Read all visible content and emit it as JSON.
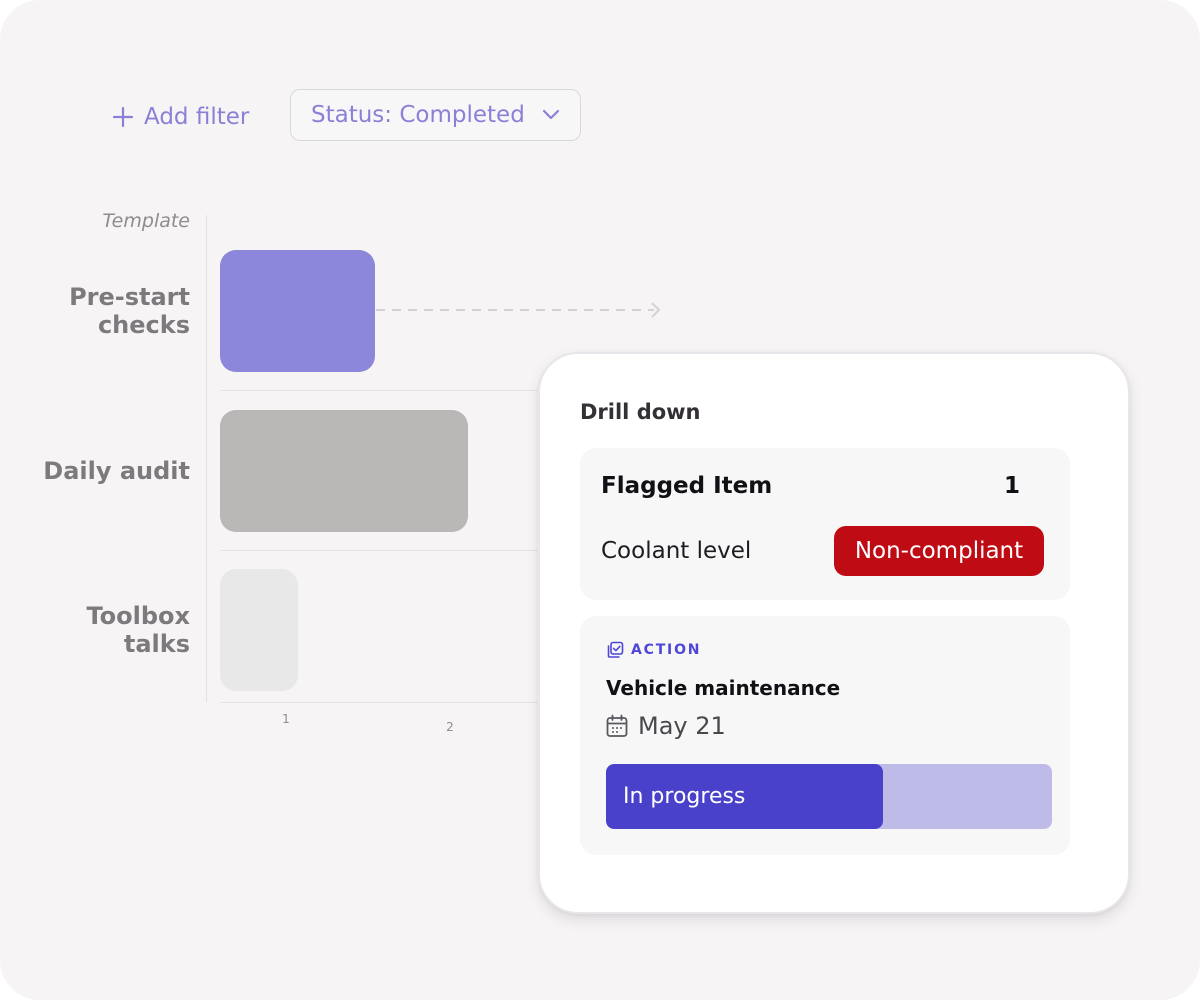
{
  "filters": {
    "add_label": "Add filter",
    "status_label": "Status: Completed"
  },
  "icons": {
    "add": "plus-icon",
    "dropdown": "chevron-down-icon",
    "action": "action-checklist-icon",
    "date": "calendar-icon",
    "drill": "dashed-arrow-right-icon"
  },
  "chart_data": {
    "type": "bar",
    "orientation": "horizontal",
    "ylabel": "Template",
    "categories": [
      "Pre-start checks",
      "Daily audit",
      "Toolbox talks"
    ],
    "values": [
      1,
      1.6,
      0.5
    ],
    "colors": [
      "#8d87dc",
      "#b9b8b7",
      "#e9e8e9"
    ],
    "xticks": [
      "1",
      "2"
    ],
    "xlim": [
      0,
      2.2
    ],
    "grid": false,
    "legend": "none"
  },
  "drilldown": {
    "title": "Drill down",
    "flagged_label": "Flagged Item",
    "flagged_count": "1",
    "item_name": "Coolant level",
    "item_status": "Non-compliant",
    "status_color": "#bf0b13",
    "action": {
      "label": "ACTION",
      "title": "Vehicle maintenance",
      "date": "May 21",
      "progress_label": "In progress",
      "progress_fraction": 0.62,
      "accent_color": "#4a41cb"
    }
  }
}
